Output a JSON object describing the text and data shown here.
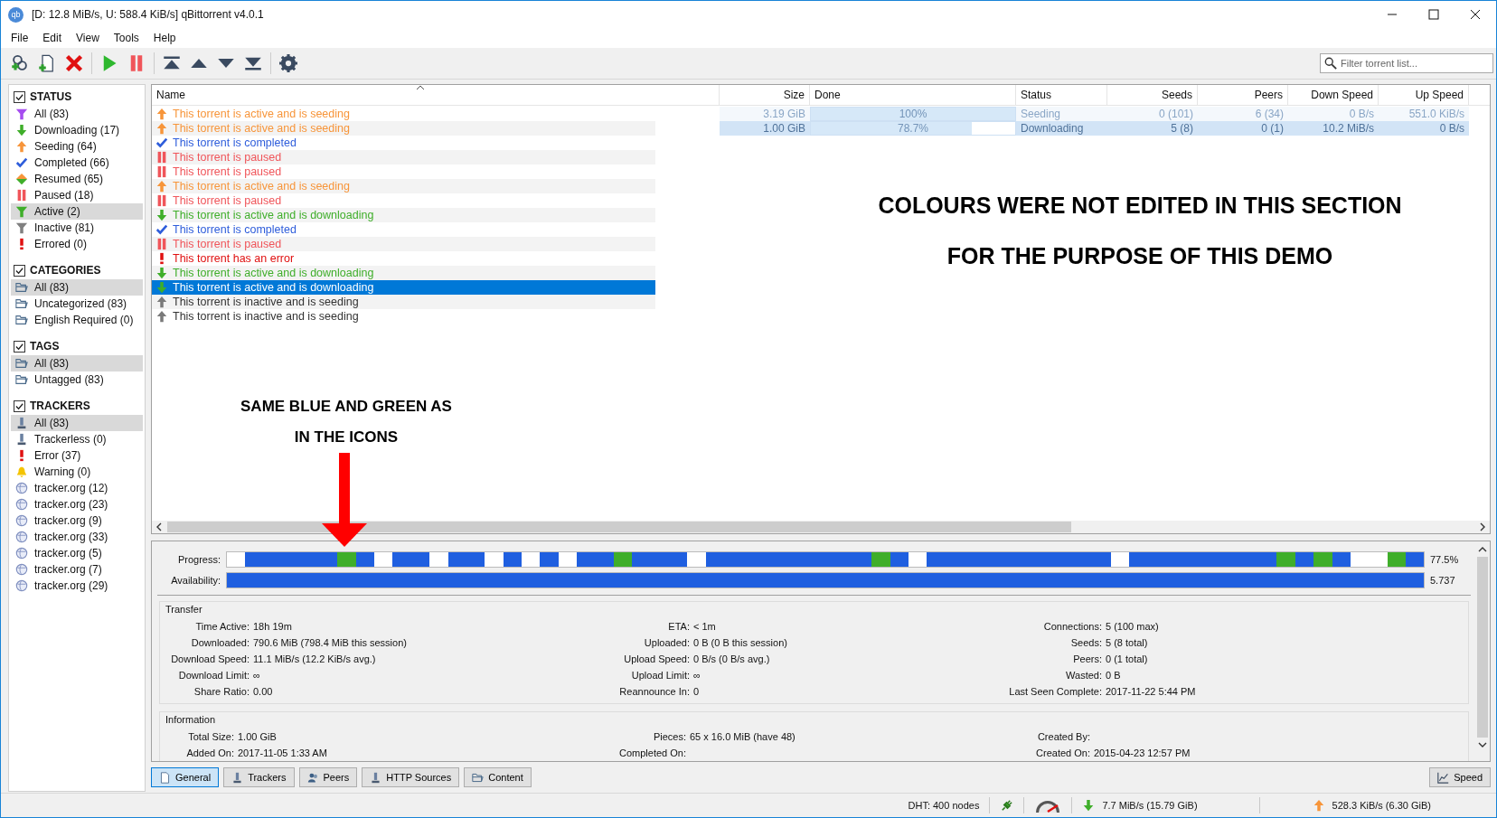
{
  "window": {
    "icon_label": "qb",
    "title": "[D: 12.8 MiB/s, U: 588.4 KiB/s] qBittorrent v4.0.1"
  },
  "menu": [
    "File",
    "Edit",
    "View",
    "Tools",
    "Help"
  ],
  "toolbar": [
    {
      "buttons": [
        {
          "kind": "add_link"
        },
        {
          "kind": "add_file"
        },
        {
          "kind": "delete"
        }
      ]
    },
    {
      "buttons": [
        {
          "kind": "resume"
        },
        {
          "kind": "pause"
        }
      ]
    },
    {
      "buttons": [
        {
          "kind": "top"
        },
        {
          "kind": "up"
        },
        {
          "kind": "down"
        },
        {
          "kind": "bottom"
        }
      ]
    },
    {
      "buttons": [
        {
          "kind": "settings"
        }
      ]
    }
  ],
  "search": {
    "placeholder": "Filter torrent list..."
  },
  "sidebar": [
    {
      "title": "STATUS",
      "checked": true,
      "items": [
        {
          "label": "All (83)",
          "kind": "all",
          "selected": false
        },
        {
          "label": "Downloading (17)",
          "kind": "downloading",
          "selected": false
        },
        {
          "label": "Seeding (64)",
          "kind": "seeding",
          "selected": false
        },
        {
          "label": "Completed (66)",
          "kind": "completed",
          "selected": false
        },
        {
          "label": "Resumed (65)",
          "kind": "resumed",
          "selected": false
        },
        {
          "label": "Paused (18)",
          "kind": "paused",
          "selected": false
        },
        {
          "label": "Active (2)",
          "kind": "active",
          "selected": true
        },
        {
          "label": "Inactive (81)",
          "kind": "inactive",
          "selected": false
        },
        {
          "label": "Errored (0)",
          "kind": "errored",
          "selected": false
        }
      ]
    },
    {
      "title": "CATEGORIES",
      "checked": true,
      "items": [
        {
          "label": "All (83)",
          "kind": "folder",
          "selected": true
        },
        {
          "label": "Uncategorized (83)",
          "kind": "folder",
          "selected": false
        },
        {
          "label": "English Required (0)",
          "kind": "folder",
          "selected": false
        }
      ]
    },
    {
      "title": "TAGS",
      "checked": true,
      "items": [
        {
          "label": "All (83)",
          "kind": "folder",
          "selected": true
        },
        {
          "label": "Untagged (83)",
          "kind": "folder",
          "selected": false
        }
      ]
    },
    {
      "title": "TRACKERS",
      "checked": true,
      "items": [
        {
          "label": "All (83)",
          "kind": "tracker",
          "selected": true
        },
        {
          "label": "Trackerless (0)",
          "kind": "tracker",
          "selected": false
        },
        {
          "label": "Error (37)",
          "kind": "errored",
          "selected": false
        },
        {
          "label": "Warning (0)",
          "kind": "warning",
          "selected": false
        },
        {
          "label": "tracker.org (12)",
          "kind": "globe",
          "selected": false
        },
        {
          "label": "tracker.org (23)",
          "kind": "globe",
          "selected": false
        },
        {
          "label": "tracker.org (9)",
          "kind": "globe",
          "selected": false
        },
        {
          "label": "tracker.org (33)",
          "kind": "globe",
          "selected": false
        },
        {
          "label": "tracker.org (5)",
          "kind": "globe",
          "selected": false
        },
        {
          "label": "tracker.org (7)",
          "kind": "globe",
          "selected": false
        },
        {
          "label": "tracker.org (29)",
          "kind": "globe",
          "selected": false
        }
      ]
    }
  ],
  "table": {
    "columns": [
      "Name",
      "Size",
      "Done",
      "Status",
      "Seeds",
      "Peers",
      "Down Speed",
      "Up Speed"
    ],
    "rows": [
      {
        "name": "This torrent is active and is seeding",
        "kind": "seeding",
        "selected": false,
        "size": "3.19 GiB",
        "done": "100%",
        "level": 1,
        "status": "Seeding",
        "seeds": "0 (101)",
        "peers": "6 (34)",
        "down_speed": "0 B/s",
        "up_speed": "551.0 KiB/s"
      },
      {
        "name": "This torrent is active and is seeding",
        "kind": "seeding",
        "selected": false,
        "size": "1.00 GiB",
        "done": "78.7%",
        "level": 0.787,
        "status": "Downloading",
        "seeds": "5 (8)",
        "peers": "0 (1)",
        "down_speed": "10.2 MiB/s",
        "up_speed": "0 B/s"
      },
      {
        "name": "This torrent is completed",
        "kind": "completed",
        "selected": false
      },
      {
        "name": "This torrent is paused",
        "kind": "paused",
        "selected": false
      },
      {
        "name": "This torrent is paused",
        "kind": "paused",
        "selected": false
      },
      {
        "name": "This torrent is active and is seeding",
        "kind": "seeding",
        "selected": false
      },
      {
        "name": "This torrent is paused",
        "kind": "paused",
        "selected": false
      },
      {
        "name": "This torrent is active and is downloading",
        "kind": "downloading",
        "selected": false
      },
      {
        "name": "This torrent is completed",
        "kind": "completed",
        "selected": false
      },
      {
        "name": "This torrent is paused",
        "kind": "paused",
        "selected": false
      },
      {
        "name": "This torrent has an error",
        "kind": "error",
        "selected": false
      },
      {
        "name": "This torrent is active and is downloading",
        "kind": "downloading",
        "selected": false
      },
      {
        "name": "This torrent is active and is downloading",
        "kind": "downloading",
        "selected": true
      },
      {
        "name": "This torrent is inactive and is seeding",
        "kind": "inactive_seeding",
        "selected": false
      },
      {
        "name": "This torrent is inactive and is seeding",
        "kind": "inactive_seeding",
        "selected": false
      }
    ]
  },
  "annotations": [
    {
      "lines": [
        "COLOURS WERE NOT EDITED IN THIS SECTION",
        "FOR THE PURPOSE OF THIS DEMO"
      ],
      "kind": "note"
    },
    {
      "lines": [
        "SAME BLUE AND GREEN AS",
        "IN THE ICONS"
      ],
      "kind": "pointer"
    }
  ],
  "details": {
    "progress": {
      "label": "Progress:",
      "reading": "77.5%",
      "pieces": [
        {
          "kind": "missing"
        },
        {
          "kind": "have"
        },
        {
          "kind": "have"
        },
        {
          "kind": "have"
        },
        {
          "kind": "have"
        },
        {
          "kind": "have"
        },
        {
          "kind": "downloading"
        },
        {
          "kind": "have"
        },
        {
          "kind": "missing"
        },
        {
          "kind": "have"
        },
        {
          "kind": "have"
        },
        {
          "kind": "missing"
        },
        {
          "kind": "have"
        },
        {
          "kind": "have"
        },
        {
          "kind": "missing"
        },
        {
          "kind": "have"
        },
        {
          "kind": "missing"
        },
        {
          "kind": "have"
        },
        {
          "kind": "missing"
        },
        {
          "kind": "have"
        },
        {
          "kind": "have"
        },
        {
          "kind": "downloading"
        },
        {
          "kind": "have"
        },
        {
          "kind": "have"
        },
        {
          "kind": "have"
        },
        {
          "kind": "missing"
        },
        {
          "kind": "have"
        },
        {
          "kind": "have"
        },
        {
          "kind": "have"
        },
        {
          "kind": "have"
        },
        {
          "kind": "have"
        },
        {
          "kind": "have"
        },
        {
          "kind": "have"
        },
        {
          "kind": "have"
        },
        {
          "kind": "have"
        },
        {
          "kind": "downloading"
        },
        {
          "kind": "have"
        },
        {
          "kind": "missing"
        },
        {
          "kind": "have"
        },
        {
          "kind": "have"
        },
        {
          "kind": "have"
        },
        {
          "kind": "have"
        },
        {
          "kind": "have"
        },
        {
          "kind": "have"
        },
        {
          "kind": "have"
        },
        {
          "kind": "have"
        },
        {
          "kind": "have"
        },
        {
          "kind": "have"
        },
        {
          "kind": "missing"
        },
        {
          "kind": "have"
        },
        {
          "kind": "have"
        },
        {
          "kind": "have"
        },
        {
          "kind": "have"
        },
        {
          "kind": "have"
        },
        {
          "kind": "have"
        },
        {
          "kind": "have"
        },
        {
          "kind": "have"
        },
        {
          "kind": "downloading"
        },
        {
          "kind": "have"
        },
        {
          "kind": "downloading"
        },
        {
          "kind": "have"
        },
        {
          "kind": "missing"
        },
        {
          "kind": "missing"
        },
        {
          "kind": "downloading"
        },
        {
          "kind": "have"
        }
      ]
    },
    "availability": {
      "label": "Availability:",
      "reading": "5.737",
      "level": 1
    },
    "groups": [
      {
        "title": "Transfer",
        "columns": [
          [
            {
              "label": "Time Active:",
              "value": "18h 19m"
            },
            {
              "label": "Downloaded:",
              "value": "790.6 MiB (798.4 MiB this session)"
            },
            {
              "label": "Download Speed:",
              "value": "11.1 MiB/s (12.2 KiB/s avg.)"
            },
            {
              "label": "Download Limit:",
              "value": "∞"
            },
            {
              "label": "Share Ratio:",
              "value": "0.00"
            }
          ],
          [
            {
              "label": "ETA:",
              "value": "< 1m"
            },
            {
              "label": "Uploaded:",
              "value": "0 B (0 B this session)"
            },
            {
              "label": "Upload Speed:",
              "value": "0 B/s (0 B/s avg.)"
            },
            {
              "label": "Upload Limit:",
              "value": "∞"
            },
            {
              "label": "Reannounce In:",
              "value": "0"
            }
          ],
          [
            {
              "label": "Connections:",
              "value": "5 (100 max)"
            },
            {
              "label": "Seeds:",
              "value": "5 (8 total)"
            },
            {
              "label": "Peers:",
              "value": "0 (1 total)"
            },
            {
              "label": "Wasted:",
              "value": "0 B"
            },
            {
              "label": "Last Seen Complete:",
              "value": "2017-11-22 5:44 PM"
            }
          ]
        ]
      },
      {
        "title": "Information",
        "columns": [
          [
            {
              "label": "Total Size:",
              "value": "1.00 GiB"
            },
            {
              "label": "Added On:",
              "value": "2017-11-05 1:33 AM"
            }
          ],
          [
            {
              "label": "Pieces:",
              "value": "65 x 16.0 MiB (have 48)"
            },
            {
              "label": "Completed On:"
            }
          ],
          [
            {
              "label": "Created By:"
            },
            {
              "label": "Created On:",
              "value": "2015-04-23 12:57 PM"
            }
          ]
        ]
      }
    ]
  },
  "tabs": [
    {
      "label": "General",
      "kind": "general",
      "selected": true
    },
    {
      "label": "Trackers",
      "kind": "tracker",
      "selected": false
    },
    {
      "label": "Peers",
      "kind": "peers",
      "selected": false
    },
    {
      "label": "HTTP Sources",
      "kind": "tracker",
      "selected": false
    },
    {
      "label": "Content",
      "kind": "folder",
      "selected": false
    }
  ],
  "speed_button": {
    "label": "Speed"
  },
  "status_bar": {
    "dht": "DHT: 400 nodes",
    "download": "7.7 MiB/s (15.79 GiB)",
    "upload": "528.3 KiB/s (6.30 GiB)"
  }
}
